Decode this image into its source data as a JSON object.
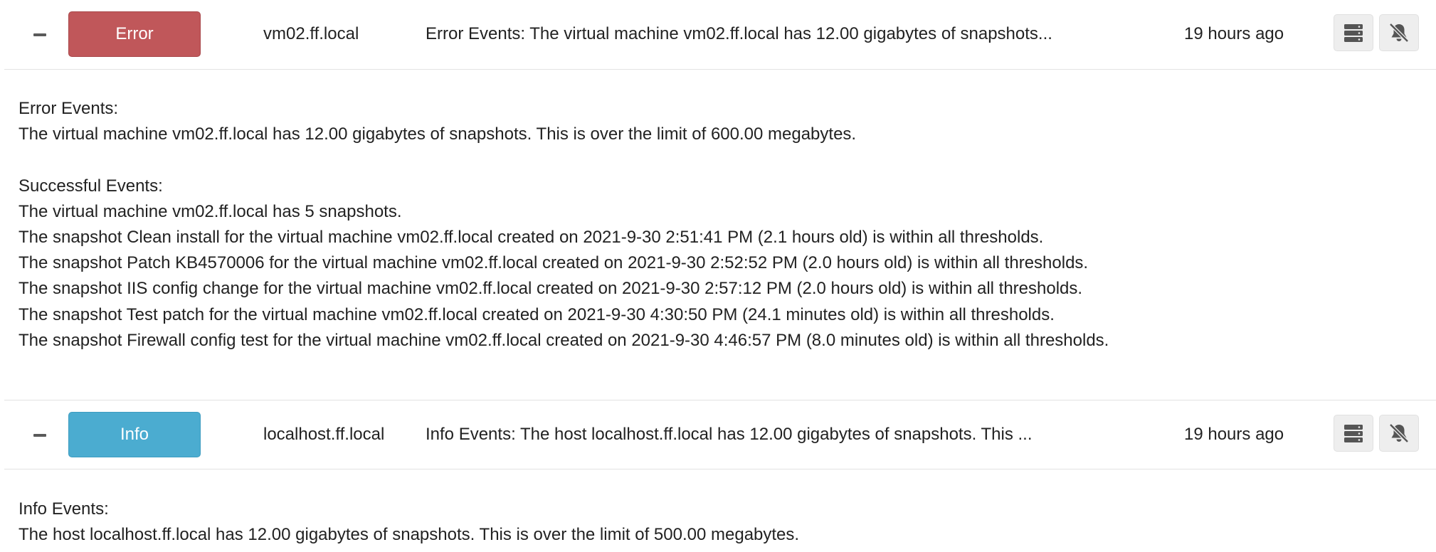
{
  "events": [
    {
      "collapse_symbol": "−",
      "severity": "Error",
      "color": "#c0575a",
      "host": "vm02.ff.local",
      "summary": "Error Events: The virtual machine vm02.ff.local has 12.00 gigabytes of snapshots...",
      "time": "19 hours ago",
      "details": {
        "primary_heading": "Error Events:",
        "primary_lines": [
          "The virtual machine vm02.ff.local has 12.00 gigabytes of snapshots. This is over the limit of 600.00 megabytes."
        ],
        "secondary_heading": "Successful Events:",
        "secondary_lines": [
          "The virtual machine vm02.ff.local has 5 snapshots.",
          "The snapshot Clean install for the virtual machine vm02.ff.local created on 2021-9-30 2:51:41 PM (2.1 hours old) is within all thresholds.",
          "The snapshot Patch KB4570006 for the virtual machine vm02.ff.local created on 2021-9-30 2:52:52 PM (2.0 hours old) is within all thresholds.",
          "The snapshot IIS config change for the virtual machine vm02.ff.local created on 2021-9-30 2:57:12 PM (2.0 hours old) is within all thresholds.",
          "The snapshot Test patch for the virtual machine vm02.ff.local created on 2021-9-30 4:30:50 PM (24.1 minutes old) is within all thresholds.",
          "The snapshot Firewall config test for the virtual machine vm02.ff.local created on 2021-9-30 4:46:57 PM (8.0 minutes old) is within all thresholds."
        ]
      }
    },
    {
      "collapse_symbol": "−",
      "severity": "Info",
      "color": "#4bacd0",
      "host": "localhost.ff.local",
      "summary": "Info Events: The host localhost.ff.local has 12.00 gigabytes of snapshots. This ...",
      "time": "19 hours ago",
      "details": {
        "primary_heading": "Info Events:",
        "primary_lines": [
          "The host localhost.ff.local has 12.00 gigabytes of snapshots. This is over the limit of 500.00 megabytes."
        ]
      }
    }
  ],
  "icons": {
    "details": "database-icon",
    "mute": "bell-slash-icon"
  }
}
